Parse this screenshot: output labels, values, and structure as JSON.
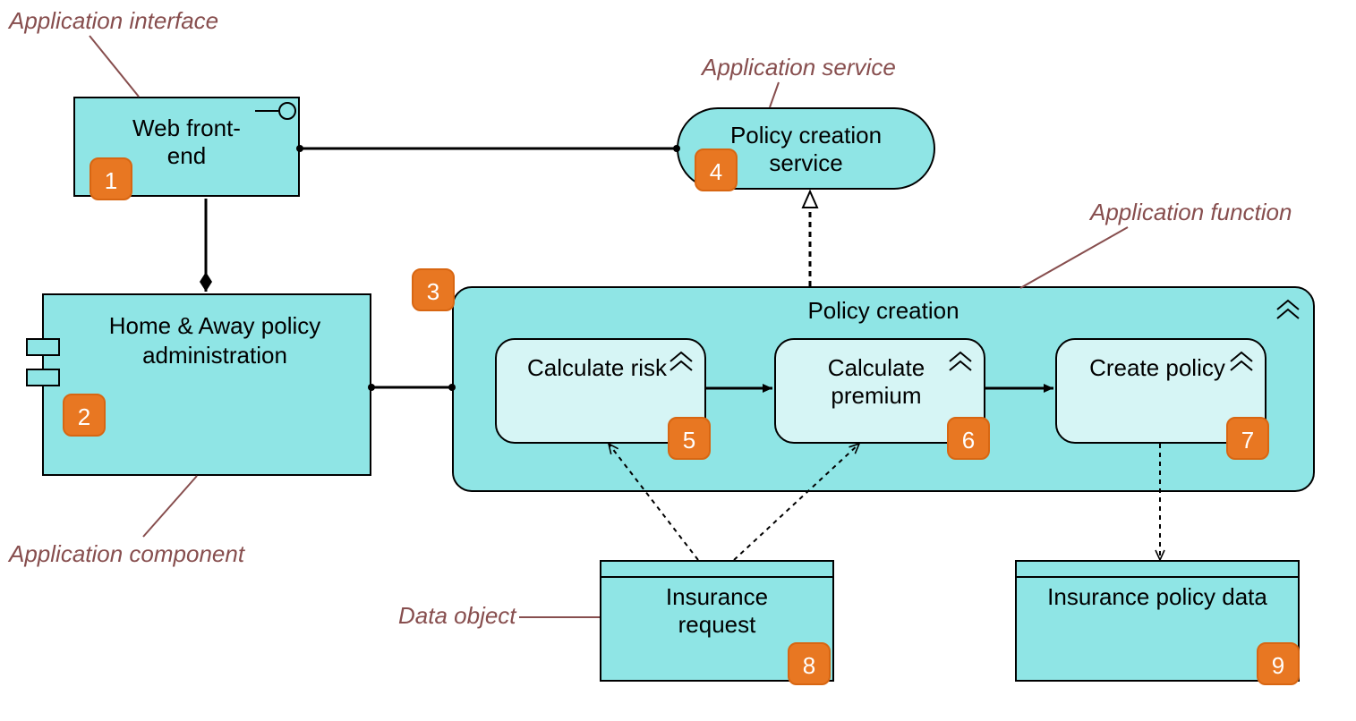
{
  "annotations": {
    "interface": "Application interface",
    "service": "Application service",
    "function": "Application function",
    "component": "Application component",
    "data": "Data object"
  },
  "nodes": {
    "web_front_end": "Web front-\nend",
    "home_away": "Home & Away policy administration",
    "policy_creation_service": "Policy creation service",
    "policy_creation": "Policy creation",
    "calc_risk": "Calculate risk",
    "calc_premium": "Calculate premium",
    "create_policy": "Create policy",
    "insurance_request": "Insurance request",
    "insurance_policy_data": "Insurance policy data"
  },
  "badges": {
    "b1": "1",
    "b2": "2",
    "b3": "3",
    "b4": "4",
    "b5": "5",
    "b6": "6",
    "b7": "7",
    "b8": "8",
    "b9": "9"
  },
  "colors": {
    "fill_main": "#8fe5e5",
    "fill_light": "#d6f5f5",
    "annotation": "#874e4e",
    "badge": "#e87722"
  }
}
